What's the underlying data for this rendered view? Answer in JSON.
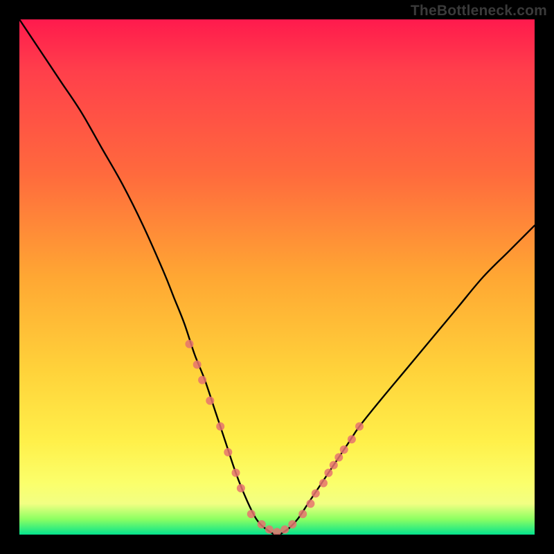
{
  "watermark": {
    "text": "TheBottleneck.com"
  },
  "colors": {
    "frame": "#000000",
    "curve_stroke": "#000000",
    "marker_fill": "#E6736E",
    "gradient_stops": [
      "#ff1a4d",
      "#ff6a3d",
      "#ffd23a",
      "#fbff6b",
      "#04e38e"
    ]
  },
  "chart_data": {
    "type": "line",
    "title": "",
    "xlabel": "",
    "ylabel": "",
    "xlim": [
      0,
      100
    ],
    "ylim": [
      0,
      100
    ],
    "curve_note": "V-shaped bottleneck curve; y≈100 at x≈0, minimum y≈0 at x≈46–52, rising to y≈60 at x≈100. Left arm steeper than right.",
    "series": [
      {
        "name": "bottleneck-curve",
        "x": [
          0,
          4,
          8,
          12,
          16,
          20,
          24,
          28,
          30,
          32,
          34,
          36,
          38,
          40,
          42,
          44,
          46,
          48,
          50,
          52,
          54,
          56,
          58,
          60,
          62,
          64,
          66,
          70,
          75,
          80,
          85,
          90,
          95,
          100
        ],
        "y": [
          100,
          94,
          88,
          82,
          75,
          68,
          60,
          51,
          46,
          41,
          35,
          30,
          24,
          18,
          12,
          7,
          3,
          1,
          0,
          1,
          3,
          6,
          9,
          12,
          15,
          18,
          21,
          26,
          32,
          38,
          44,
          50,
          55,
          60
        ]
      }
    ],
    "markers_left": {
      "name": "highlighted-points-left-arm",
      "x": [
        33,
        34.5,
        35.5,
        37,
        39,
        40.5,
        42,
        43
      ],
      "y": [
        37,
        33,
        30,
        26,
        21,
        16,
        12,
        9
      ]
    },
    "markers_bottom": {
      "name": "highlighted-points-valley",
      "x": [
        45,
        47,
        48.5,
        50,
        51.5,
        53,
        55,
        56.5
      ],
      "y": [
        4,
        2,
        1,
        0.5,
        1,
        2,
        4,
        6
      ]
    },
    "markers_right": {
      "name": "highlighted-points-right-arm",
      "x": [
        57.5,
        59,
        60,
        61,
        62,
        63,
        64.5,
        66
      ],
      "y": [
        8,
        10,
        12,
        13.5,
        15,
        16.5,
        18.5,
        21
      ]
    }
  }
}
